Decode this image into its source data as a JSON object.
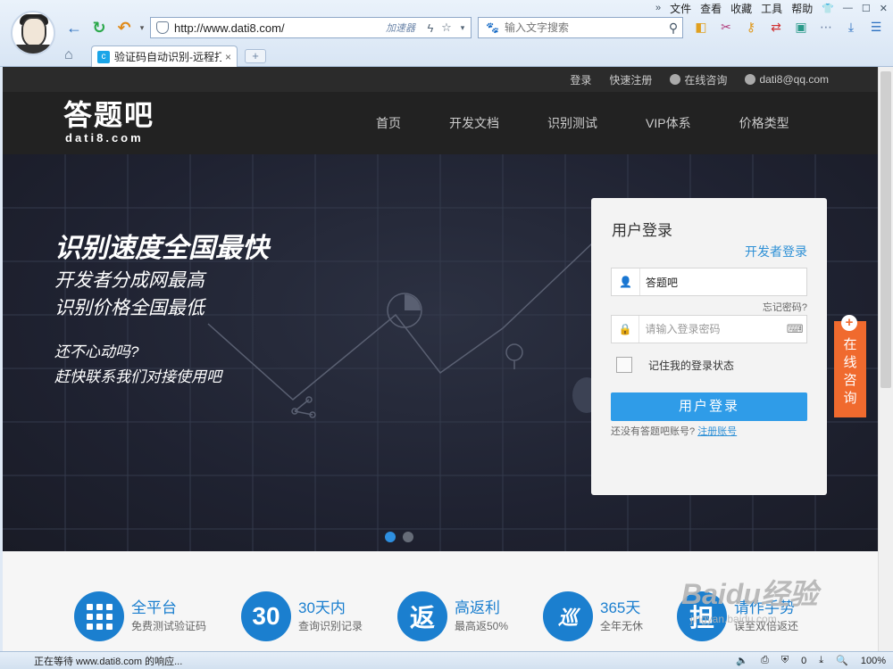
{
  "browser": {
    "menu": [
      "文件",
      "查看",
      "收藏",
      "工具",
      "帮助"
    ],
    "menu_overflow": "»",
    "address_url": "http://www.dati8.com/",
    "accelerator": "加速器",
    "search_placeholder": "输入文字搜索",
    "tab_title": "验证码自动识别-远程打码",
    "newtab": "+",
    "tab_close": "×",
    "status_text": "正在等待 www.dati8.com 的响应...",
    "status_count": "0",
    "zoom": "100%"
  },
  "site": {
    "topbar": {
      "login": "登录",
      "register": "快速注册",
      "online": "在线咨询",
      "email": "dati8@qq.com"
    },
    "logo_cn": "答题吧",
    "logo_en": "dati8.com",
    "nav": [
      "首页",
      "开发文档",
      "识别测试",
      "VIP体系",
      "价格类型"
    ],
    "hero": {
      "line1": "识别速度全国最快",
      "line2": "开发者分成网最高",
      "line3": "识别价格全国最低",
      "line4": "还不心动吗?",
      "line5": "赶快联系我们对接使用吧"
    },
    "login": {
      "title": "用户登录",
      "developer": "开发者登录",
      "username_value": "答题吧",
      "forgot": "忘记密码?",
      "password_placeholder": "请输入登录密码",
      "remember": "记住我的登录状态",
      "button": "用户登录",
      "no_account": "还没有答题吧账号?",
      "register_link": "注册账号"
    },
    "consult_label": "在线咨询",
    "features": [
      {
        "title": "全平台",
        "sub": "免费测试验证码",
        "badge": ""
      },
      {
        "title": "30天内",
        "sub": "查询识别记录",
        "badge": "30"
      },
      {
        "title": "高返利",
        "sub": "最高返50%",
        "badge": "返"
      },
      {
        "title": "365天",
        "sub": "全年无休",
        "badge": "巡"
      },
      {
        "title": "请作手势",
        "sub": "误至双倍返还",
        "badge": "担"
      }
    ],
    "watermark_brand": "Baidu经验",
    "watermark_url": "jingyan.baidu.com"
  },
  "colors": {
    "accent": "#2f9ce8",
    "feature_blue": "#1b7fcf",
    "consult_orange": "#f06a2e"
  }
}
